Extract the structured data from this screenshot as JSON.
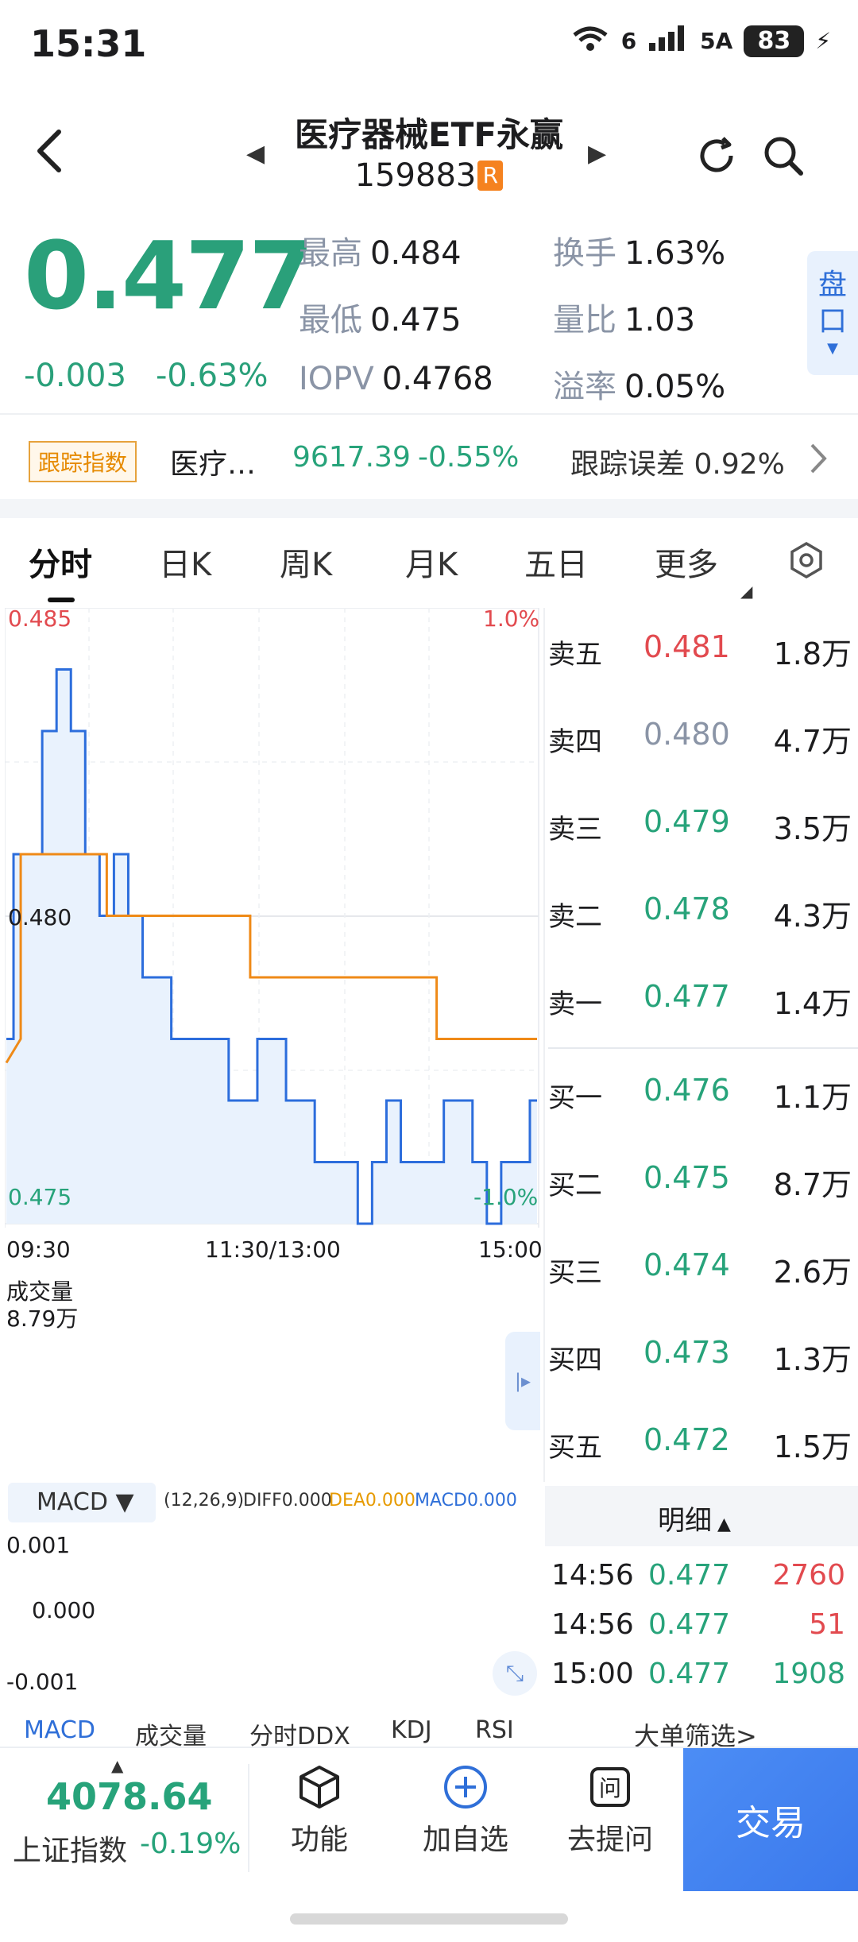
{
  "status_bar": {
    "time": "15:31",
    "network1": "6",
    "network2": "5A",
    "battery": "83"
  },
  "header": {
    "title": "医疗器械ETF永赢",
    "code": "159883",
    "badge": "R"
  },
  "quote": {
    "price": "0.477",
    "change": "-0.003",
    "change_pct": "-0.63%",
    "stats": {
      "high_k": "最高",
      "high_v": "0.484",
      "low_k": "最低",
      "low_v": "0.475",
      "iopv_k": "IOPV",
      "iopv_v": "0.4768",
      "turnover_k": "换手",
      "turnover_v": "1.63%",
      "vol_ratio_k": "量比",
      "vol_ratio_v": "1.03",
      "premium_k": "溢率",
      "premium_v": "0.05%"
    },
    "pankou": "盘口"
  },
  "tracking": {
    "tag": "跟踪指数",
    "name": "医疗…",
    "value": "9617.39",
    "pct": "-0.55%",
    "error_k": "跟踪误差",
    "error_v": "0.92%"
  },
  "tabs": [
    "分时",
    "日K",
    "周K",
    "月K",
    "五日",
    "更多"
  ],
  "chart": {
    "top_price": "0.485",
    "mid_price": "0.480",
    "bottom_price": "0.475",
    "top_pct": "1.0%",
    "bottom_pct": "-1.0%",
    "time_start": "09:30",
    "time_mid": "11:30/13:00",
    "time_end": "15:00",
    "volume_label": "成交量",
    "volume_max": "8.79万",
    "macd_label": "MACD",
    "macd_params": "(12,26,9)",
    "diff": "DIFF0.000",
    "dea": "DEA0.000",
    "macd": "MACD0.000",
    "macd_top": "0.001",
    "macd_mid": "0.000",
    "macd_bottom": "-0.001"
  },
  "chart_data": {
    "type": "line",
    "title": "",
    "x_range": [
      "09:30",
      "15:00"
    ],
    "ylim": [
      0.475,
      0.485
    ],
    "series": [
      {
        "values": [
          0.478,
          0.481,
          0.481,
          0.483,
          0.484,
          0.483,
          0.481,
          0.48,
          0.481,
          0.48,
          0.479,
          0.479,
          0.478,
          0.478,
          0.478,
          0.478,
          0.477,
          0.477,
          0.478,
          0.478,
          0.477,
          0.477,
          0.476,
          0.476,
          0.476,
          0.475,
          0.476,
          0.477,
          0.476,
          0.476,
          0.476,
          0.477,
          0.477,
          0.476,
          0.475,
          0.476,
          0.476,
          0.477
        ]
      },
      {
        "values": [
          0.478,
          0.481,
          0.481,
          0.481,
          0.481,
          0.481,
          0.481,
          0.48,
          0.48,
          0.48,
          0.48,
          0.48,
          0.48,
          0.48,
          0.48,
          0.48,
          0.48,
          0.479,
          0.479,
          0.479,
          0.479,
          0.479,
          0.479,
          0.479,
          0.479,
          0.479,
          0.479,
          0.479,
          0.479,
          0.479,
          0.478,
          0.478,
          0.478,
          0.478,
          0.478,
          0.478,
          0.478,
          0.478
        ]
      }
    ]
  },
  "order_book": {
    "asks": [
      {
        "label": "卖五",
        "price": "0.481",
        "vol": "1.8万",
        "color": "#e24a4f"
      },
      {
        "label": "卖四",
        "price": "0.480",
        "vol": "4.7万",
        "color": "#8a94a6"
      },
      {
        "label": "卖三",
        "price": "0.479",
        "vol": "3.5万",
        "color": "#27a37a"
      },
      {
        "label": "卖二",
        "price": "0.478",
        "vol": "4.3万",
        "color": "#27a37a"
      },
      {
        "label": "卖一",
        "price": "0.477",
        "vol": "1.4万",
        "color": "#27a37a"
      }
    ],
    "bids": [
      {
        "label": "买一",
        "price": "0.476",
        "vol": "1.1万",
        "color": "#27a37a"
      },
      {
        "label": "买二",
        "price": "0.475",
        "vol": "8.7万",
        "color": "#27a37a"
      },
      {
        "label": "买三",
        "price": "0.474",
        "vol": "2.6万",
        "color": "#27a37a"
      },
      {
        "label": "买四",
        "price": "0.473",
        "vol": "1.3万",
        "color": "#27a37a"
      },
      {
        "label": "买五",
        "price": "0.472",
        "vol": "1.5万",
        "color": "#27a37a"
      }
    ]
  },
  "details": {
    "header": "明细",
    "rows": [
      {
        "time": "14:56",
        "price": "0.477",
        "vol": "2760",
        "vol_color": "#e24a4f"
      },
      {
        "time": "14:56",
        "price": "0.477",
        "vol": "51",
        "vol_color": "#e24a4f"
      },
      {
        "time": "15:00",
        "price": "0.477",
        "vol": "1908",
        "vol_color": "#27a37a"
      }
    ],
    "filter": "大单筛选>"
  },
  "indicator_tabs": [
    "MACD",
    "成交量",
    "分时DDX",
    "KDJ",
    "RSI"
  ],
  "bottom_bar": {
    "index_value": "4078.64",
    "index_name": "上证指数",
    "index_pct": "-0.19%",
    "func": "功能",
    "add_fav": "加自选",
    "ask": "去提问",
    "trade": "交易"
  }
}
